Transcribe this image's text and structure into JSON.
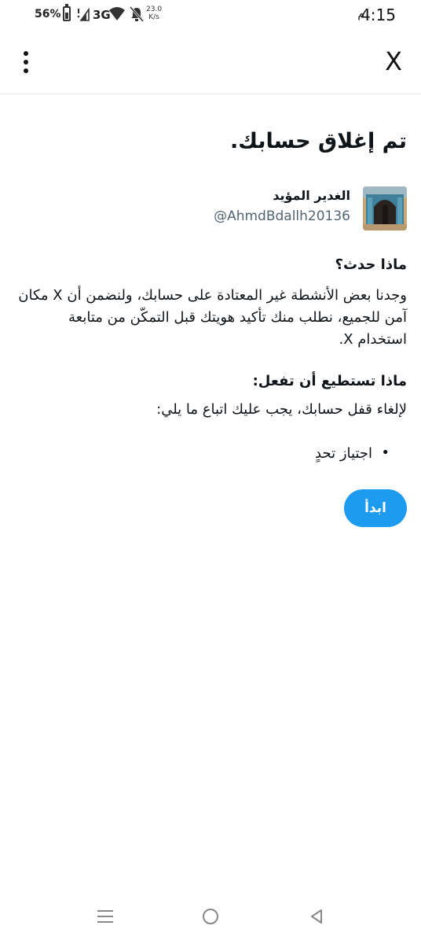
{
  "status_bar": {
    "battery_percent": "56%",
    "network": "3G",
    "speed_value": "23.0",
    "speed_unit": "K/s",
    "time": "4:15",
    "ampm": "م"
  },
  "header": {
    "menu_icon": "kebab-menu-icon",
    "close_label": "X"
  },
  "main": {
    "title": "تم إغلاق حسابك.",
    "account": {
      "name": "الغدير المؤيد",
      "handle": "@AhmdBdallh20136"
    },
    "what_happened_heading": "ماذا حدث؟",
    "what_happened_body": "وجدنا بعض الأنشطة غير المعتادة على حسابك، ولنضمن أن X مكان آمن للجميع، نطلب منك تأكيد هويتك قبل التمكّن من متابعة استخدام X.",
    "what_you_can_do_heading": "ماذا تستطيع أن تفعل:",
    "what_you_can_do_body": "لإلغاء قفل حسابك، يجب عليك اتباع ما يلي:",
    "steps": [
      "اجتياز تحدٍ"
    ],
    "start_button": "ابدأ"
  },
  "colors": {
    "accent": "#1d9bf0",
    "handle_gray": "#536471",
    "text": "#0f1419"
  },
  "nav": {
    "recents_icon": "recents-icon",
    "home_icon": "home-circle-icon",
    "back_icon": "back-triangle-icon"
  }
}
